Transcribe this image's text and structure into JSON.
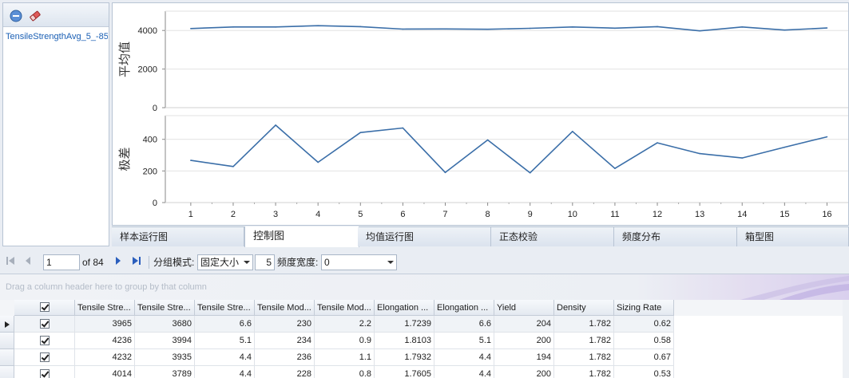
{
  "left_panel": {
    "items": [
      "TensileStrengthAvg_5_-85"
    ]
  },
  "chart_data": [
    {
      "type": "line",
      "title": "",
      "xlabel": "",
      "ylabel": "平均值",
      "x": [
        1,
        2,
        3,
        4,
        5,
        6,
        7,
        8,
        9,
        10,
        11,
        12,
        13,
        14,
        15,
        16
      ],
      "series": [
        {
          "values": [
            4100,
            4180,
            4180,
            4250,
            4200,
            4070,
            4080,
            4060,
            4110,
            4180,
            4120,
            4200,
            3980,
            4180,
            4020,
            4130
          ]
        }
      ],
      "ylim": [
        0,
        5000
      ],
      "yticks": [
        0,
        2000,
        4000
      ],
      "grid": true,
      "color": "#3a6ea8"
    },
    {
      "type": "line",
      "title": "",
      "xlabel": "",
      "ylabel": "极差",
      "x": [
        1,
        2,
        3,
        4,
        5,
        6,
        7,
        8,
        9,
        10,
        11,
        12,
        13,
        14,
        15,
        16
      ],
      "series": [
        {
          "values": [
            267,
            228,
            490,
            255,
            443,
            472,
            190,
            396,
            188,
            450,
            216,
            378,
            310,
            282,
            350,
            416
          ]
        }
      ],
      "ylim": [
        0,
        550
      ],
      "yticks": [
        0,
        200,
        400
      ],
      "grid": true,
      "color": "#3a6ea8"
    }
  ],
  "chart_tabs": [
    "样本运行图",
    "控制图",
    "均值运行图",
    "正态校验",
    "频度分布",
    "箱型图"
  ],
  "navigator": {
    "current_page": "1",
    "page_count": "of 84",
    "group_mode_label": "分组模式:",
    "group_mode_value": "固定大小",
    "group_size": "5",
    "freq_width_label": "频度宽度:",
    "freq_width_value": "0"
  },
  "grid": {
    "group_panel_text": "Drag a column header here to group by that column",
    "columns": [
      "Tensile Stre...",
      "Tensile Stre...",
      "Tensile Stre...",
      "Tensile Mod...",
      "Tensile Mod...",
      "Elongation ...",
      "Elongation ...",
      "Yield",
      "Density",
      "Sizing Rate"
    ],
    "rows": [
      {
        "checked": true,
        "values": [
          "3965",
          "3680",
          "6.6",
          "230",
          "2.2",
          "1.7239",
          "6.6",
          "204",
          "1.782",
          "0.62"
        ]
      },
      {
        "checked": true,
        "values": [
          "4236",
          "3994",
          "5.1",
          "234",
          "0.9",
          "1.8103",
          "5.1",
          "200",
          "1.782",
          "0.58"
        ]
      },
      {
        "checked": true,
        "values": [
          "4232",
          "3935",
          "4.4",
          "236",
          "1.1",
          "1.7932",
          "4.4",
          "194",
          "1.782",
          "0.67"
        ]
      },
      {
        "checked": true,
        "values": [
          "4014",
          "3789",
          "4.4",
          "228",
          "0.8",
          "1.7605",
          "4.4",
          "200",
          "1.782",
          "0.53"
        ]
      }
    ]
  }
}
